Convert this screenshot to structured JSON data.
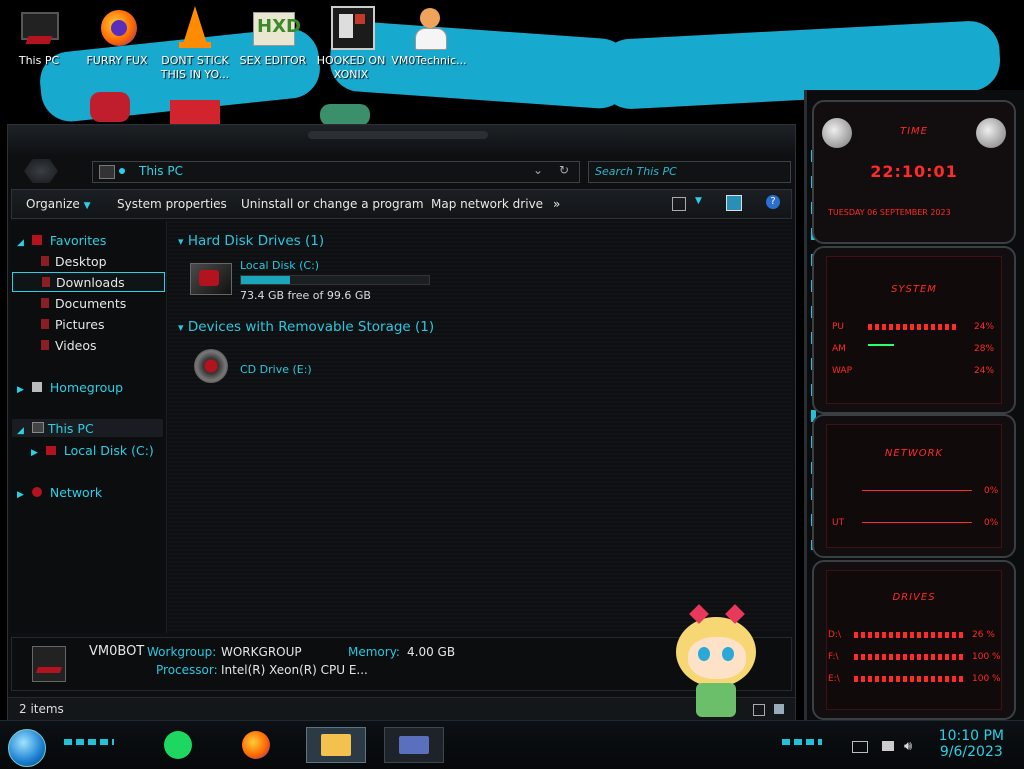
{
  "desktop_icons": [
    {
      "label": "This PC"
    },
    {
      "label": "FURRY FUX"
    },
    {
      "label": "DONT STICK THIS IN YO..."
    },
    {
      "label": "SEX EDITOR"
    },
    {
      "label": "HOOKED ON XONIX"
    },
    {
      "label": "VM0Technic..."
    }
  ],
  "explorer": {
    "address": "This PC",
    "search_placeholder": "Search This PC",
    "toolbar": {
      "organize": "Organize",
      "system_properties": "System properties",
      "uninstall": "Uninstall or change a program",
      "map_drive": "Map network drive",
      "more": "»"
    },
    "nav": {
      "favorites": "Favorites",
      "desktop": "Desktop",
      "downloads": "Downloads",
      "documents": "Documents",
      "pictures": "Pictures",
      "videos": "Videos",
      "homegroup": "Homegroup",
      "this_pc": "This PC",
      "local_disk": "Local Disk (C:)",
      "network": "Network"
    },
    "groups": {
      "hdd_header": "Hard Disk Drives (1)",
      "removable_header": "Devices with Removable Storage (1)"
    },
    "drives": {
      "c_name": "Local Disk (C:)",
      "c_free": "73.4 GB free of 99.6 GB",
      "c_used_fraction": 0.26,
      "e_name": "CD Drive (E:)"
    },
    "details": {
      "computer_name": "VM0BOT",
      "workgroup_label": "Workgroup:",
      "workgroup_value": "WORKGROUP",
      "memory_label": "Memory:",
      "memory_value": "4.00 GB",
      "processor_label": "Processor:",
      "processor_value": "Intel(R) Xeon(R) CPU E..."
    },
    "status": "2 items"
  },
  "gadgets": {
    "time_title": "TIME",
    "time_value": "22:10:01",
    "date_value": "TUESDAY 06 SEPTEMBER 2023",
    "system_title": "SYSTEM",
    "cpu_label": "PU",
    "cpu_value": "24%",
    "ram_label": "AM",
    "ram_value": "28%",
    "swap_label": "WAP",
    "swap_value": "24%",
    "network_title": "NETWORK",
    "net_in": "0%",
    "net_out_label": "UT",
    "net_out": "0%",
    "drives_title": "DRIVES",
    "drive1_label": "D:\\",
    "drive1_value": "26 %",
    "drive2_label": "F:\\",
    "drive2_value": "100 %",
    "drive3_label": "E:\\",
    "drive3_value": "100 %"
  },
  "taskbar": {
    "time": "10:10 PM",
    "date": "9/6/2023"
  },
  "colors": {
    "accent": "#2bd0e6",
    "alert": "#ff2a2a"
  }
}
